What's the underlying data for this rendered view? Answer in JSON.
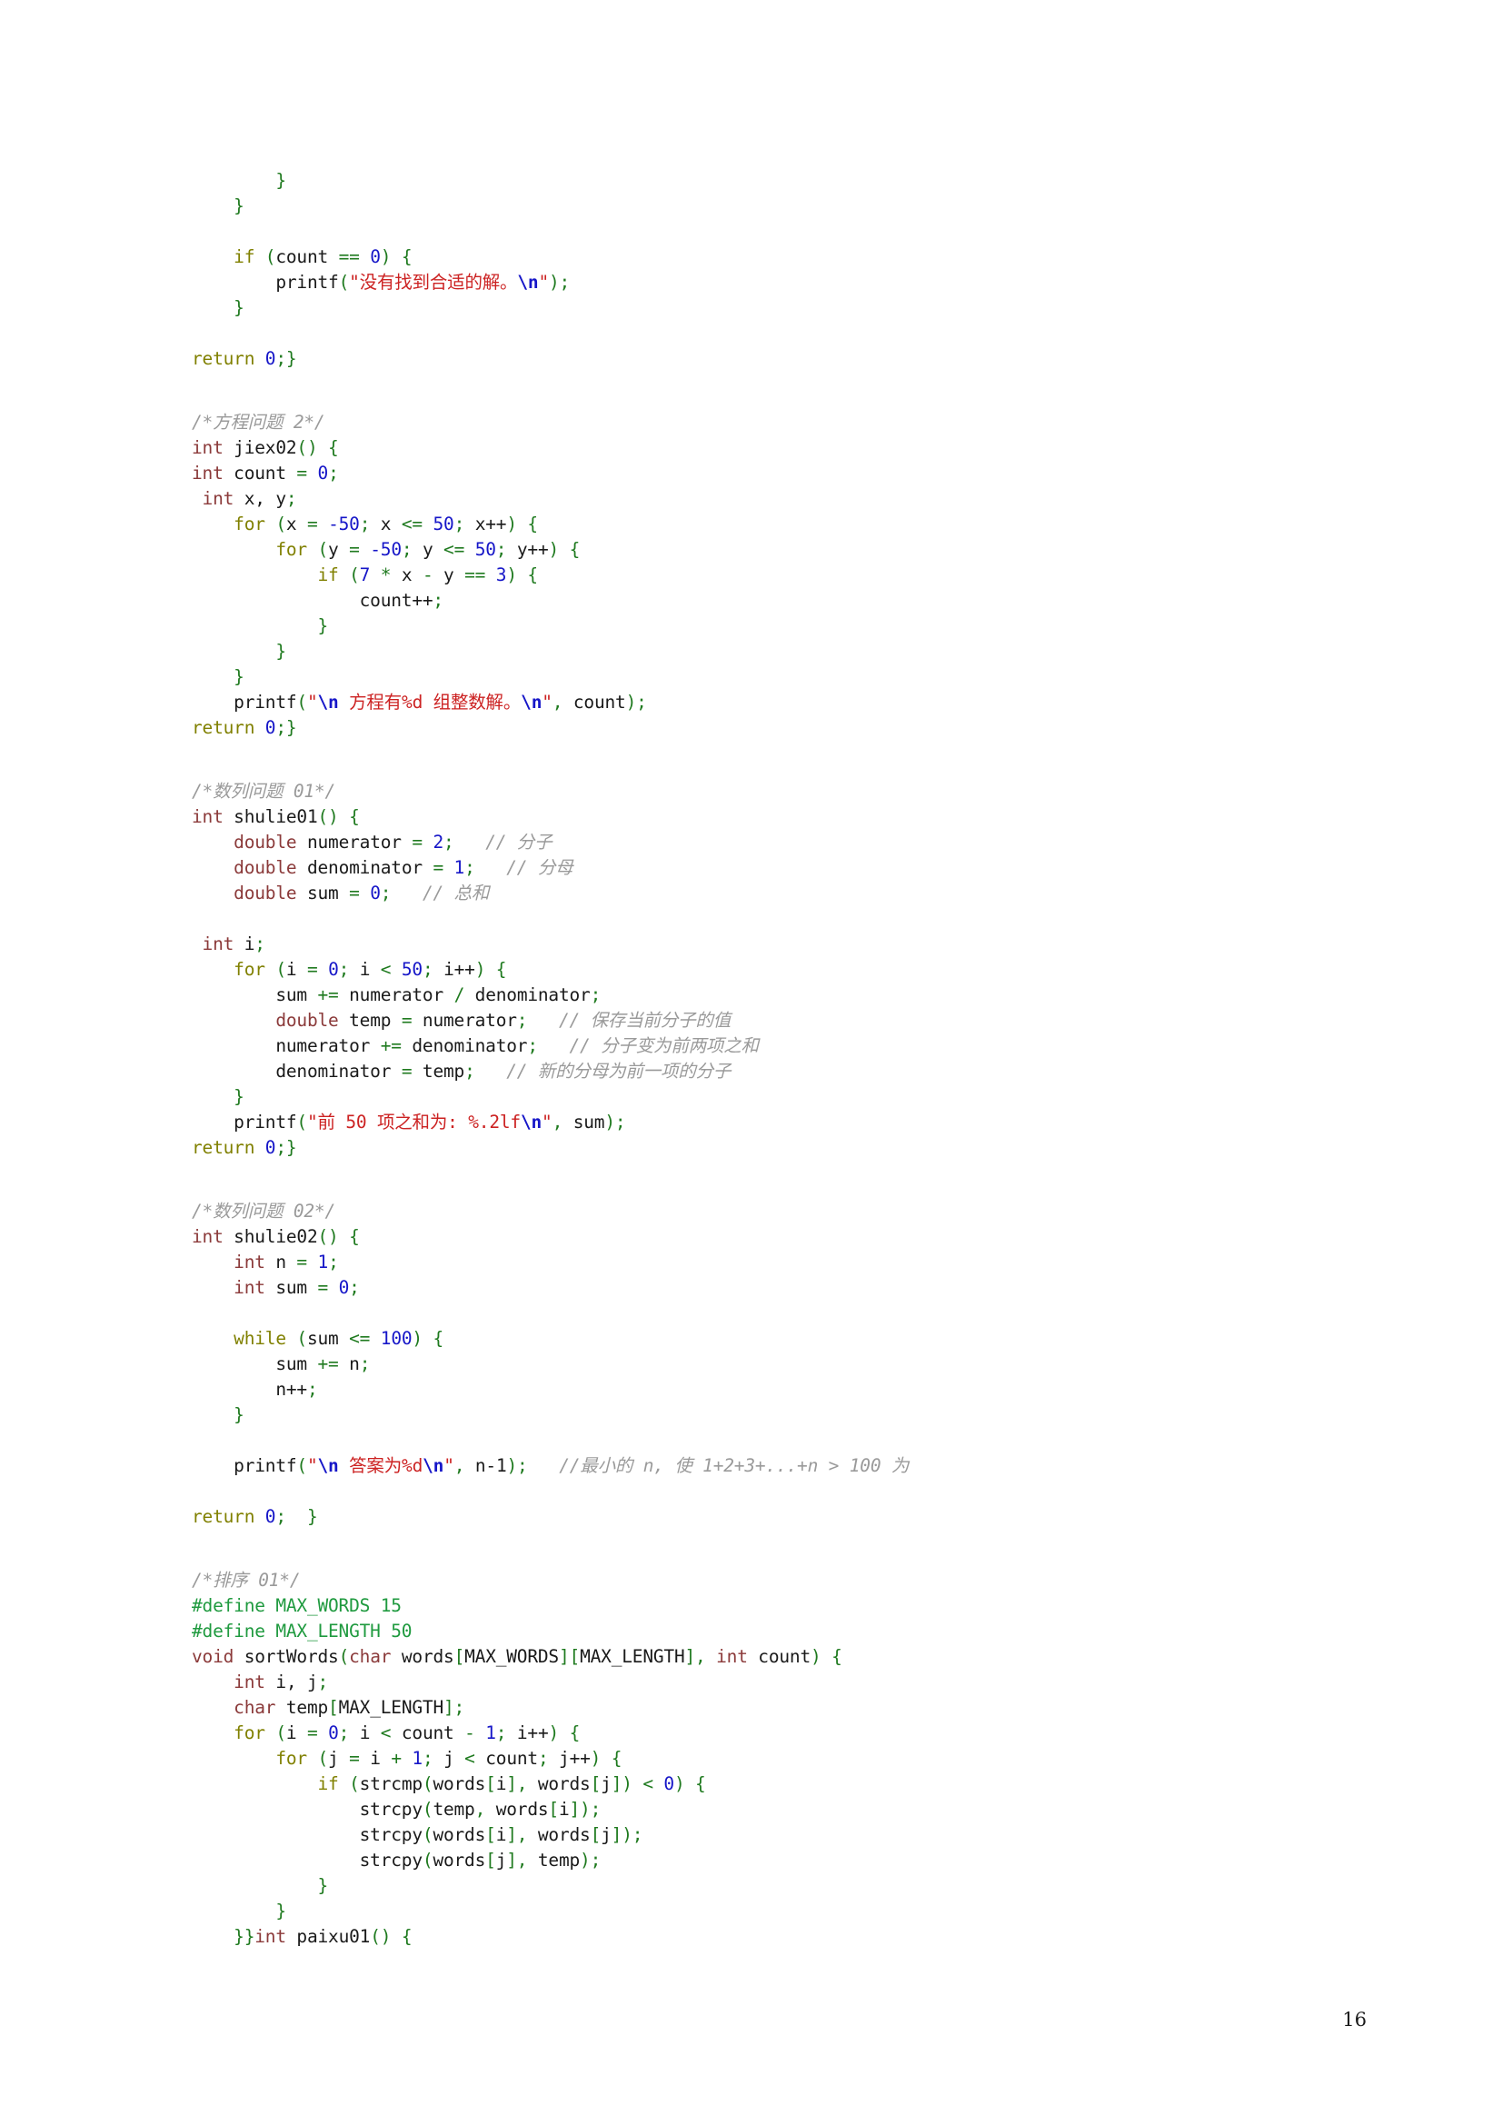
{
  "document": {
    "page_number": "16",
    "colors": {
      "keyword": "#808000",
      "type": "#8b3a3a",
      "number": "#1616c8",
      "string": "#cc2222",
      "escape": "#1616c8",
      "punctuation": "#1f7a1f",
      "comment": "#9a9a9a",
      "preprocessor": "#1f9a3f",
      "identifier": "#1a1a1a",
      "background": "#ffffff"
    }
  },
  "code": {
    "l001": "        }",
    "l002": "    }",
    "l003": "    if (count == 0) {",
    "l004": "        printf(\"没有找到合适的解。\\n\");",
    "l005": "    }",
    "l006": "return 0;}",
    "l007": "/*方程问题 2*/",
    "l008": "int jiex02() {",
    "l009": "int count = 0;",
    "l010": " int x, y;",
    "l011": "    for (x = -50; x <= 50; x++) {",
    "l012": "        for (y = -50; y <= 50; y++) {",
    "l013": "            if (7 * x - y == 3) {",
    "l014": "                count++;",
    "l015": "            }",
    "l016": "        }",
    "l017": "    }",
    "l018": "    printf(\"\\n方程有%d 组整数解。\\n\", count);",
    "l019": "return 0;}",
    "l020": "/*数列问题 01*/",
    "l021": "int shulie01() {",
    "l022": "    double numerator = 2;   // 分子",
    "l023": "    double denominator = 1;   // 分母",
    "l024": "    double sum = 0;   // 总和",
    "l025": " int i;",
    "l026": "    for (i = 0; i < 50; i++) {",
    "l027": "        sum += numerator / denominator;",
    "l028": "        double temp = numerator;   // 保存当前分子的值",
    "l029": "        numerator += denominator;   // 分子变为前两项之和",
    "l030": "        denominator = temp;   // 新的分母为前一项的分子",
    "l031": "    }",
    "l032": "    printf(\"前 50 项之和为: %.2lf\\n\", sum);",
    "l033": "return 0;}",
    "l034": "/*数列问题 02*/",
    "l035": "int shulie02() {",
    "l036": "    int n = 1;",
    "l037": "    int sum = 0;",
    "l038": "    while (sum <= 100) {",
    "l039": "        sum += n;",
    "l040": "        n++;",
    "l041": "    }",
    "l042": "    printf(\"\\n答案为%d\\n\", n-1);   //最小的 n, 使 1+2+3+...+n > 100 为",
    "l043": "return 0;  }",
    "l044": "/*排序 01*/",
    "l045": "#define MAX_WORDS 15",
    "l046": "#define MAX_LENGTH 50",
    "l047": "void sortWords(char words[MAX_WORDS][MAX_LENGTH], int count) {",
    "l048": "    int i, j;",
    "l049": "    char temp[MAX_LENGTH];",
    "l050": "    for (i = 0; i < count - 1; i++) {",
    "l051": "        for (j = i + 1; j < count; j++) {",
    "l052": "            if (strcmp(words[i], words[j]) < 0) {",
    "l053": "                strcpy(temp, words[i]);",
    "l054": "                strcpy(words[i], words[j]);",
    "l055": "                strcpy(words[j], temp);",
    "l056": "            }",
    "l057": "        }",
    "l058": "    }}int paixu01() {"
  },
  "tokens": {
    "kw_if": "if",
    "kw_for": "for",
    "kw_while": "while",
    "kw_return": "return",
    "type_int": "int",
    "type_double": "double",
    "type_char": "char",
    "type_void": "void",
    "fn_printf": "printf",
    "fn_strcmp": "strcmp",
    "fn_strcpy": "strcpy",
    "fn_sortWords": "sortWords",
    "fn_jiex02": "jiex02",
    "fn_shulie01": "shulie01",
    "fn_shulie02": "shulie02",
    "fn_paixu01": "paixu01",
    "str_no_solution": "没有找到合适的解。",
    "str_equation": "方程有%d 组整数解。",
    "str_sum50": "前 50 项之和为: %.2lf",
    "str_answer": "答案为%d",
    "com_equation2": "/*方程问题 2*/",
    "com_series1": "/*数列问题 01*/",
    "com_series2": "/*数列问题 02*/",
    "com_sort1": "/*排序 01*/",
    "com_numerator": "// 分子",
    "com_denominator": "// 分母",
    "com_sum": "// 总和",
    "com_save_numerator": "// 保存当前分子的值",
    "com_numerator_becomes": "// 分子变为前两项之和",
    "com_new_denominator": "// 新的分母为前一项的分子",
    "com_min_n": "//最小的 n, 使 1+2+3+...+n > 100 为",
    "define_max_words": "#define MAX_WORDS 15",
    "define_max_length": "#define MAX_LENGTH 50",
    "macro_max_words": "MAX_WORDS",
    "macro_max_length": "MAX_LENGTH",
    "escape_n": "\\n"
  }
}
